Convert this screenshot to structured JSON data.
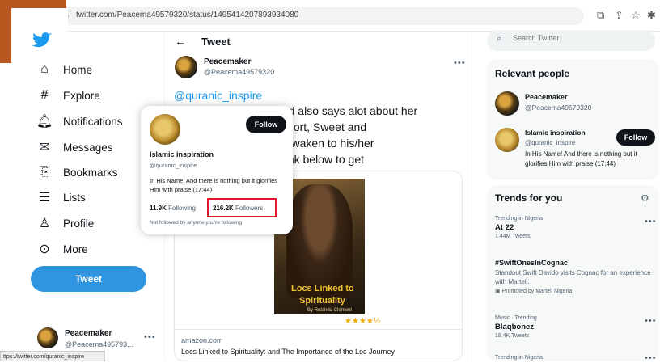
{
  "browser": {
    "url": "twitter.com/Peacema49579320/status/1495414207893934080",
    "status_url": "ttps://twitter.com/quranic_inspire"
  },
  "nav": {
    "items": [
      {
        "label": "Home",
        "icon": "home-icon"
      },
      {
        "label": "Explore",
        "icon": "hashtag-icon"
      },
      {
        "label": "Notifications",
        "icon": "bell-icon"
      },
      {
        "label": "Messages",
        "icon": "envelope-icon"
      },
      {
        "label": "Bookmarks",
        "icon": "bookmark-icon"
      },
      {
        "label": "Lists",
        "icon": "list-icon"
      },
      {
        "label": "Profile",
        "icon": "person-icon"
      },
      {
        "label": "More",
        "icon": "more-circle-icon"
      }
    ],
    "tweet_button": "Tweet",
    "account_name": "Peacemaker",
    "account_handle": "@Peacema495793..."
  },
  "main": {
    "header_title": "Tweet",
    "author_name": "Peacemaker",
    "author_handle": "@Peacema49579320",
    "mention": "@quranic_inspire",
    "body_lines": [
      "Ch...................thing and also says alot about her",
      "...................t even it. Short, Sweet and",
      "...................your child awaken to his/her",
      "...................ck on the link below to get"
    ],
    "book_title_line1": "Locs Linked to",
    "book_title_line2": "Spirituality",
    "book_author": "By Rolanda Clement",
    "rating": "★★★★½",
    "link_domain": "amazon.com",
    "link_title": "Locs Linked to Spirituality: and The Importance of the Loc Journey"
  },
  "hover_card": {
    "follow_label": "Follow",
    "name": "Islamic inspiration",
    "handle": "@quranic_inspire",
    "bio": "In His Name! And there is nothing but it glorifies Him with praise.(17:44)",
    "following_count": "11.9K",
    "following_label": "Following",
    "followers_count": "216.2K",
    "followers_label": "Followers",
    "footer": "Not followed by anyone you're following"
  },
  "sidebar": {
    "search_placeholder": "Search Twitter",
    "relevant_title": "Relevant people",
    "people": [
      {
        "name": "Peacemaker",
        "handle": "@Peacema49579320"
      },
      {
        "name": "Islamic inspiration",
        "handle": "@quranic_inspire",
        "follow": "Follow",
        "bio": "In His Name! And there is nothing but it glorifies Him with praise.(17:44)"
      }
    ],
    "trends_title": "Trends for you",
    "trends": [
      {
        "context": "Trending in Nigeria",
        "name": "At 22",
        "count": "1.44M Tweets"
      },
      {
        "name": "#SwiftOnesInCognac",
        "desc": "Standout Swift Davido visits Cognac for an experience with Martell.",
        "promoted": "Promoted by Martell Nigeria"
      },
      {
        "context": "Music · Trending",
        "name": "Blaqbonez",
        "count": "19.4K Tweets"
      },
      {
        "context": "Trending in Nigeria"
      }
    ]
  },
  "colors": {
    "twitter_blue": "#1d9bf0",
    "highlight_red": "#e0182b",
    "brand_orange": "#b8571f"
  }
}
